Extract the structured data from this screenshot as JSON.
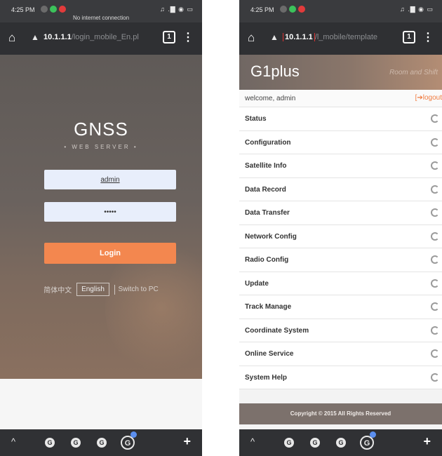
{
  "left": {
    "status": {
      "time": "4:25 PM",
      "notice": "No internet connection",
      "right_icons": "♫ .▇ ◉ ▭"
    },
    "url_bar": {
      "host": "10.1.1.1",
      "path": "/login_mobile_En.pl",
      "tab_count": "1"
    },
    "login": {
      "title": "GNSS",
      "subtitle": "• WEB SERVER •",
      "username_value": "admin",
      "password_value": "•••••",
      "login_label": "Login",
      "lang_chinese": "简体中文",
      "lang_english": "English",
      "switch_pc": "Switch to PC"
    }
  },
  "right": {
    "status": {
      "time": "4:25 PM",
      "right_icons": "♫ .▇ ◉ ▭"
    },
    "url_bar": {
      "host": "10.1.1.1",
      "path": "/l_mobile/template",
      "tab_count": "1"
    },
    "header": {
      "title": "G1plus",
      "tagline": "Room and Shift"
    },
    "welcome": "welcome, admin",
    "logout_label": "logout",
    "menu": [
      "Status",
      "Configuration",
      "Satellite Info",
      "Data Record",
      "Data Transfer",
      "Network Config",
      "Radio Config",
      "Update",
      "Track Manage",
      "Coordinate System",
      "Online Service",
      "System Help"
    ],
    "copyright": "Copyright © 2015 All Rights Reserved"
  },
  "colors": {
    "accent_orange": "#f3874f",
    "input_bg": "#e8eefb",
    "chrome_dark": "#2f3033",
    "copyright_bg": "#7c716c"
  }
}
